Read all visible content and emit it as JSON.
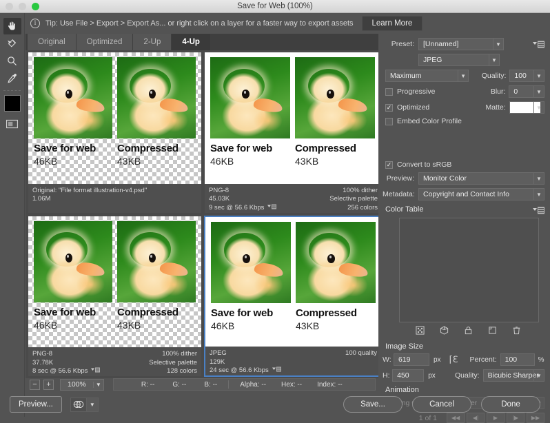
{
  "window": {
    "title": "Save for Web (100%)",
    "traffic_lights": [
      "close",
      "minimize",
      "zoom"
    ]
  },
  "tip_bar": {
    "icon": "info-icon",
    "text": "Tip: Use File > Export > Export As...  or right click on a layer for a faster way to export assets",
    "learn_more_label": "Learn More"
  },
  "toolbar": {
    "items": [
      {
        "name": "hand-tool",
        "active": true
      },
      {
        "name": "slice-select-tool",
        "active": false
      },
      {
        "name": "zoom-tool",
        "active": false
      },
      {
        "name": "eyedropper-tool",
        "active": false
      },
      {
        "name": "foreground-color-swatch",
        "color": "#000000"
      },
      {
        "name": "toggle-slices-visibility",
        "active": false
      }
    ]
  },
  "tabs": [
    {
      "label": "Original",
      "active": false
    },
    {
      "label": "Optimized",
      "active": false
    },
    {
      "label": "2-Up",
      "active": false
    },
    {
      "label": "4-Up",
      "active": true
    }
  ],
  "preview_art": {
    "left_title": "Save for web",
    "left_size": "46KB",
    "right_title": "Compressed",
    "right_size": "43KB"
  },
  "panes": [
    {
      "id": "original",
      "background": "checkerboard",
      "selected": false,
      "info_left": [
        "Original: \"File format illustration-v4.psd\"",
        "1.06M"
      ],
      "info_right": [
        "",
        ""
      ]
    },
    {
      "id": "png8-top",
      "background": "white",
      "selected": false,
      "info_left": [
        "PNG-8",
        "45.03K",
        "9 sec @ 56.6 Kbps"
      ],
      "info_right": [
        "100% dither",
        "Selective palette",
        "256 colors"
      ]
    },
    {
      "id": "png8-bottom",
      "background": "checkerboard",
      "selected": false,
      "info_left": [
        "PNG-8",
        "37.78K",
        "8 sec @ 56.6 Kbps"
      ],
      "info_right": [
        "100% dither",
        "Selective palette",
        "128 colors"
      ]
    },
    {
      "id": "jpeg",
      "background": "white",
      "selected": true,
      "selection_color": "#4a80c4",
      "info_left": [
        "JPEG",
        "129K",
        "24 sec @ 56.6 Kbps"
      ],
      "info_right": [
        "100 quality",
        "",
        ""
      ]
    }
  ],
  "status_bar": {
    "zoom_out_label": "−",
    "zoom_in_label": "+",
    "zoom_value": "100%",
    "readouts": [
      {
        "label": "R:",
        "value": "--"
      },
      {
        "label": "G:",
        "value": "--"
      },
      {
        "label": "B:",
        "value": "--"
      }
    ],
    "readouts2": [
      {
        "label": "Alpha:",
        "value": "--"
      },
      {
        "label": "Hex:",
        "value": "--"
      },
      {
        "label": "Index:",
        "value": "--"
      }
    ]
  },
  "settings": {
    "preset_label": "Preset:",
    "preset_value": "[Unnamed]",
    "format_value": "JPEG",
    "compression_value": "Maximum",
    "quality_label": "Quality:",
    "quality_value": "100",
    "progressive_label": "Progressive",
    "progressive_checked": false,
    "blur_label": "Blur:",
    "blur_value": "0",
    "optimized_label": "Optimized",
    "optimized_checked": true,
    "matte_label": "Matte:",
    "matte_color": "#ffffff",
    "embed_profile_label": "Embed Color Profile",
    "embed_profile_checked": false,
    "convert_srgb_label": "Convert to sRGB",
    "convert_srgb_checked": true,
    "preview_label": "Preview:",
    "preview_value": "Monitor Color",
    "metadata_label": "Metadata:",
    "metadata_value": "Copyright and Contact Info",
    "color_table_title": "Color Table",
    "color_table_icons": [
      "snap-to-web-palette-icon",
      "web-shift-icon",
      "lock-color-icon",
      "new-color-icon",
      "delete-color-icon"
    ],
    "image_size_title": "Image Size",
    "width_label": "W:",
    "width_value": "619",
    "width_unit": "px",
    "height_label": "H:",
    "height_value": "450",
    "height_unit": "px",
    "percent_label": "Percent:",
    "percent_value": "100",
    "percent_unit": "%",
    "resample_label": "Quality:",
    "resample_value": "Bicubic Sharper",
    "animation_title": "Animation",
    "looping_label": "Looping Options:",
    "looping_value": "Forever",
    "looping_disabled": true,
    "frame_counter": "1 of 1",
    "playback_buttons": [
      "first-frame-button",
      "previous-frame-button",
      "play-button",
      "next-frame-button",
      "last-frame-button"
    ]
  },
  "footer": {
    "preview_label": "Preview...",
    "browser_icon": "browser-preview-icon",
    "save_label": "Save...",
    "cancel_label": "Cancel",
    "done_label": "Done"
  }
}
